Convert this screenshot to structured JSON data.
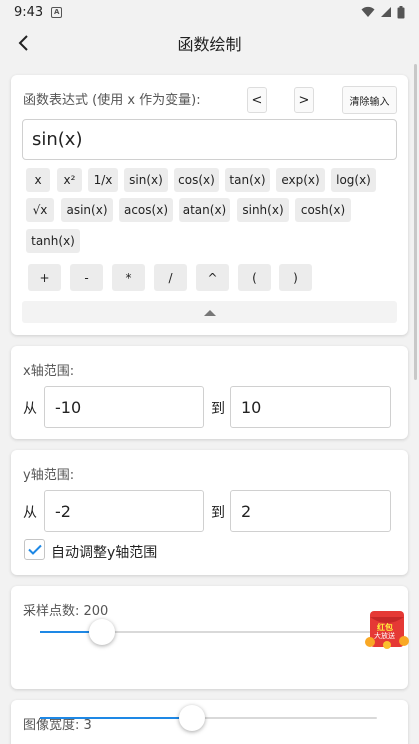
{
  "status": {
    "time": "9:43",
    "notif_letter": "A"
  },
  "appbar": {
    "title": "函数绘制"
  },
  "expression": {
    "label": "函数表达式 (使用 x 作为变量):",
    "prev_label": "<",
    "next_label": ">",
    "clear_label": "清除输入",
    "value": "sin(x)",
    "functions": [
      "x",
      "x²",
      "1/x",
      "sin(x)",
      "cos(x)",
      "tan(x)",
      "exp(x)",
      "log(x)",
      "√x",
      "asin(x)",
      "acos(x)",
      "atan(x)",
      "sinh(x)",
      "cosh(x)",
      "tanh(x)"
    ],
    "operators": [
      "+",
      "-",
      "*",
      "/",
      "^",
      "(",
      ")"
    ]
  },
  "x_range": {
    "label": "x轴范围:",
    "from_label": "从",
    "to_label": "到",
    "from": "-10",
    "to": "10"
  },
  "y_range": {
    "label": "y轴范围:",
    "from_label": "从",
    "to_label": "到",
    "from": "-2",
    "to": "2",
    "auto_label": "自动调整y轴范围",
    "auto_checked": true
  },
  "samples": {
    "label": "采样点数: 200",
    "value": 200,
    "fraction": 0.18
  },
  "width": {
    "label": "图像宽度: 3",
    "value": 3,
    "fraction": 0.45
  },
  "promo": {
    "line1": "红包",
    "line2": "大放送"
  },
  "colors": {
    "accent": "#1e88e5",
    "promo": "#e53935"
  }
}
